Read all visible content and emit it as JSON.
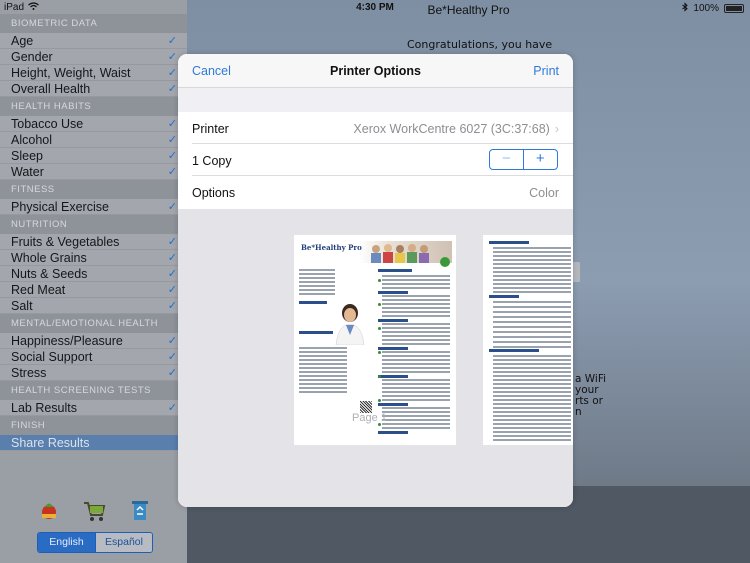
{
  "statusbar": {
    "device": "iPad",
    "time": "4:30 PM",
    "battery": "100%"
  },
  "app_title": "Be*Healthy Pro",
  "background_text": {
    "congrats": "Congratulations, you have",
    "wifi_text": "a WiFi\nyour\nrts or\nn"
  },
  "sidebar": {
    "sections": [
      {
        "header": "BIOMETRIC DATA",
        "items": [
          {
            "label": "Age",
            "checked": true
          },
          {
            "label": "Gender",
            "checked": true
          },
          {
            "label": "Height, Weight, Waist",
            "checked": true
          },
          {
            "label": "Overall Health",
            "checked": true
          }
        ]
      },
      {
        "header": "HEALTH HABITS",
        "items": [
          {
            "label": "Tobacco Use",
            "checked": true
          },
          {
            "label": "Alcohol",
            "checked": true
          },
          {
            "label": "Sleep",
            "checked": true
          },
          {
            "label": "Water",
            "checked": true
          }
        ]
      },
      {
        "header": "FITNESS",
        "items": [
          {
            "label": "Physical Exercise",
            "checked": true
          }
        ]
      },
      {
        "header": "NUTRITION",
        "items": [
          {
            "label": "Fruits & Vegetables",
            "checked": true
          },
          {
            "label": "Whole Grains",
            "checked": true
          },
          {
            "label": "Nuts & Seeds",
            "checked": true
          },
          {
            "label": "Red Meat",
            "checked": true
          },
          {
            "label": "Salt",
            "checked": true
          }
        ]
      },
      {
        "header": "MENTAL/EMOTIONAL HEALTH",
        "items": [
          {
            "label": "Happiness/Pleasure",
            "checked": true
          },
          {
            "label": "Social Support",
            "checked": true
          },
          {
            "label": "Stress",
            "checked": true
          }
        ]
      },
      {
        "header": "HEALTH SCREENING TESTS",
        "items": [
          {
            "label": "Lab Results",
            "checked": true
          }
        ]
      },
      {
        "header": "FINISH",
        "items": [
          {
            "label": "Share Results",
            "checked": false,
            "selected": true
          }
        ]
      }
    ],
    "language": {
      "english": "English",
      "spanish": "Español",
      "active": "english"
    }
  },
  "modal": {
    "cancel": "Cancel",
    "title": "Printer Options",
    "print": "Print",
    "printer_label": "Printer",
    "printer_value": "Xerox WorkCentre 6027 (3C:37:68)",
    "copies_label": "1 Copy",
    "options_label": "Options",
    "options_value": "Color",
    "page_label": "Page 1",
    "preview_title": "Be*Healthy Pro",
    "accent_color": "#2f7ad9"
  }
}
